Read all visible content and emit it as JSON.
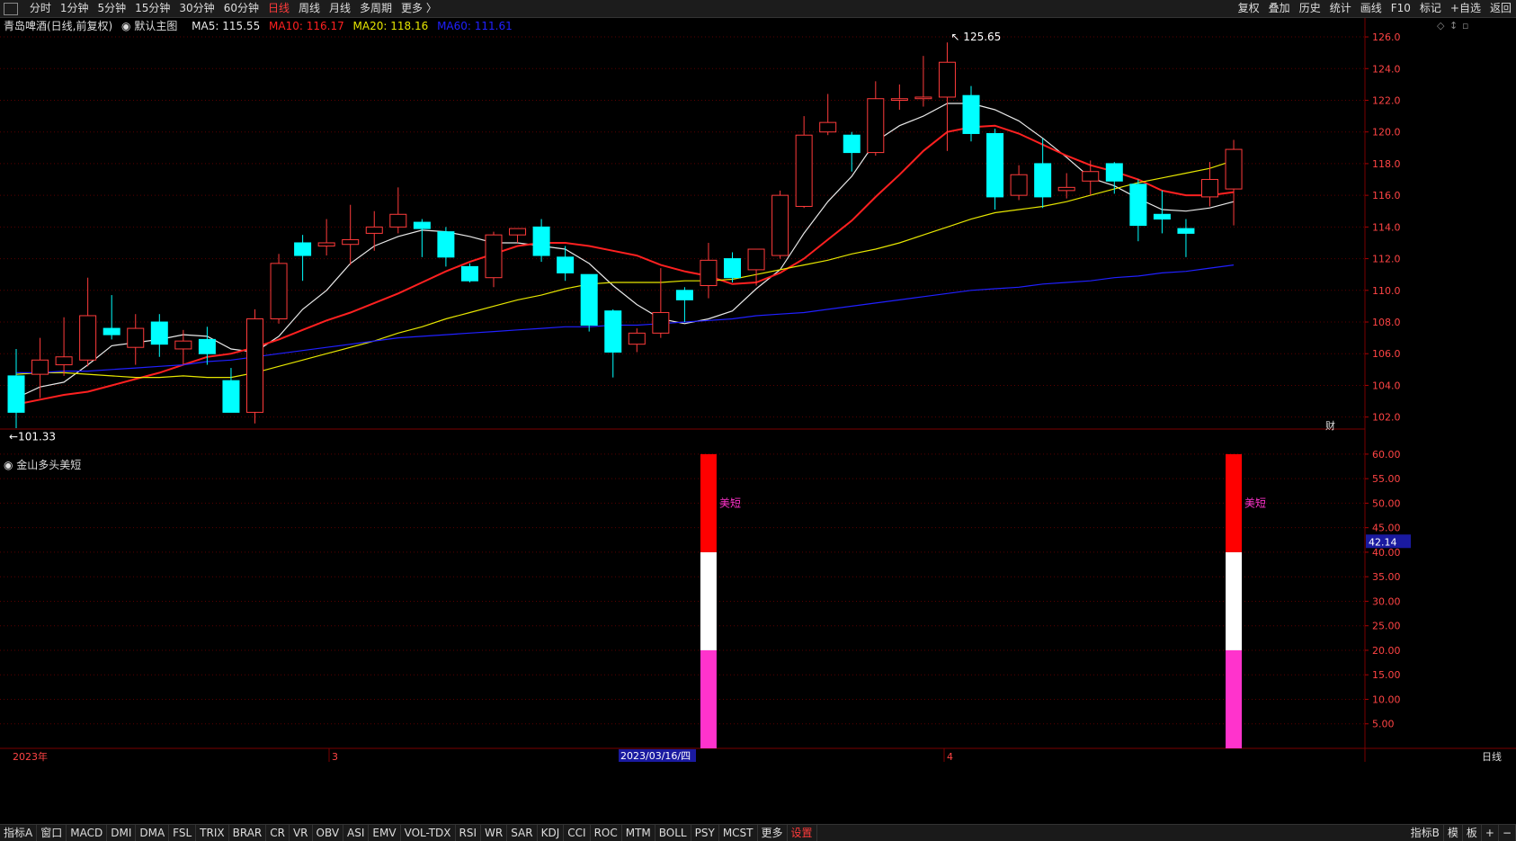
{
  "toolbar": {
    "periods": [
      "分时",
      "1分钟",
      "5分钟",
      "15分钟",
      "30分钟",
      "60分钟",
      "日线",
      "周线",
      "月线",
      "多周期",
      "更多 〉"
    ],
    "active_period": "日线",
    "right_items": [
      "复权",
      "叠加",
      "历史",
      "统计",
      "画线",
      "F10",
      "标记",
      "+自选",
      "返回"
    ]
  },
  "info": {
    "stock": "青岛啤酒(日线,前复权)",
    "main_label": "默认主图",
    "ma5": "MA5: 115.55",
    "ma10": "MA10: 116.17",
    "ma20": "MA20: 118.16",
    "ma60": "MA60: 111.61"
  },
  "sub_title": "金山多头美短",
  "bottom": {
    "indicators": [
      "指标A",
      "窗口",
      "MACD",
      "DMI",
      "DMA",
      "FSL",
      "TRIX",
      "BRAR",
      "CR",
      "VR",
      "OBV",
      "ASI",
      "EMV",
      "VOL-TDX",
      "RSI",
      "WR",
      "SAR",
      "KDJ",
      "CCI",
      "ROC",
      "MTM",
      "BOLL",
      "PSY",
      "MCST",
      "更多",
      "设置"
    ],
    "right_items": [
      "指标B",
      "模",
      "板",
      "+",
      "−"
    ]
  },
  "axis_labels": {
    "year": "2023年",
    "month3": "3",
    "cursor_date": "2023/03/16/四",
    "month4": "4",
    "period_label": "日线",
    "cursor_value": "42.14",
    "fin_marker": "财",
    "signal_label": "美短"
  },
  "colors": {
    "up": "#ff3b3b",
    "down": "#00ffff",
    "ma5": "#e8e8e8",
    "ma10": "#ff2020",
    "ma20": "#e6e600",
    "ma60": "#2020ff",
    "magenta": "#ff33cc",
    "grid": "#5a0000"
  },
  "chart_data": [
    {
      "type": "candlestick",
      "title": "青岛啤酒(日线,前复权)",
      "ylim": [
        101,
        126.5
      ],
      "y_ticks": [
        102,
        104,
        106,
        108,
        110,
        112,
        114,
        116,
        118,
        120,
        122,
        124,
        126
      ],
      "high_annotation": "125.65",
      "low_annotation": "101.33",
      "candles": [
        {
          "o": 104.6,
          "h": 106.3,
          "l": 101.3,
          "c": 102.3
        },
        {
          "o": 104.7,
          "h": 107.0,
          "l": 103.2,
          "c": 105.6
        },
        {
          "o": 105.3,
          "h": 108.3,
          "l": 104.6,
          "c": 105.8
        },
        {
          "o": 105.6,
          "h": 110.8,
          "l": 105.2,
          "c": 108.4
        },
        {
          "o": 107.6,
          "h": 109.7,
          "l": 106.9,
          "c": 107.2
        },
        {
          "o": 106.4,
          "h": 108.5,
          "l": 105.3,
          "c": 107.6
        },
        {
          "o": 108.0,
          "h": 108.5,
          "l": 105.8,
          "c": 106.6
        },
        {
          "o": 106.3,
          "h": 107.5,
          "l": 105.3,
          "c": 106.8
        },
        {
          "o": 106.9,
          "h": 107.7,
          "l": 105.3,
          "c": 106.0
        },
        {
          "o": 104.3,
          "h": 105.1,
          "l": 102.7,
          "c": 102.3
        },
        {
          "o": 102.3,
          "h": 108.8,
          "l": 101.6,
          "c": 108.2
        },
        {
          "o": 108.2,
          "h": 112.3,
          "l": 107.9,
          "c": 111.7
        },
        {
          "o": 113.0,
          "h": 113.5,
          "l": 110.6,
          "c": 112.2
        },
        {
          "o": 112.8,
          "h": 114.5,
          "l": 112.2,
          "c": 113.0
        },
        {
          "o": 112.9,
          "h": 115.4,
          "l": 111.6,
          "c": 113.2
        },
        {
          "o": 113.6,
          "h": 115.0,
          "l": 112.5,
          "c": 114.0
        },
        {
          "o": 114.0,
          "h": 116.5,
          "l": 113.6,
          "c": 114.8
        },
        {
          "o": 114.3,
          "h": 114.5,
          "l": 112.1,
          "c": 113.9
        },
        {
          "o": 113.7,
          "h": 114.0,
          "l": 111.5,
          "c": 112.1
        },
        {
          "o": 111.5,
          "h": 111.7,
          "l": 110.5,
          "c": 110.6
        },
        {
          "o": 110.8,
          "h": 113.7,
          "l": 110.2,
          "c": 113.5
        },
        {
          "o": 113.5,
          "h": 113.8,
          "l": 113.0,
          "c": 113.9
        },
        {
          "o": 114.0,
          "h": 114.5,
          "l": 111.8,
          "c": 112.2
        },
        {
          "o": 112.1,
          "h": 112.8,
          "l": 110.6,
          "c": 111.1
        },
        {
          "o": 111.0,
          "h": 111.0,
          "l": 107.4,
          "c": 107.8
        },
        {
          "o": 108.7,
          "h": 108.8,
          "l": 104.5,
          "c": 106.1
        },
        {
          "o": 106.6,
          "h": 107.6,
          "l": 106.1,
          "c": 107.3
        },
        {
          "o": 107.3,
          "h": 111.4,
          "l": 107.0,
          "c": 108.6
        },
        {
          "o": 110.0,
          "h": 110.2,
          "l": 108.0,
          "c": 109.4
        },
        {
          "o": 110.3,
          "h": 113.0,
          "l": 109.5,
          "c": 111.9
        },
        {
          "o": 112.0,
          "h": 112.4,
          "l": 110.5,
          "c": 110.8
        },
        {
          "o": 111.3,
          "h": 112.6,
          "l": 110.3,
          "c": 112.6
        },
        {
          "o": 112.2,
          "h": 116.3,
          "l": 112.0,
          "c": 116.0
        },
        {
          "o": 115.3,
          "h": 121.0,
          "l": 115.2,
          "c": 119.8
        },
        {
          "o": 120.0,
          "h": 122.4,
          "l": 119.8,
          "c": 120.6
        },
        {
          "o": 119.8,
          "h": 120.0,
          "l": 117.5,
          "c": 118.7
        },
        {
          "o": 118.7,
          "h": 123.2,
          "l": 118.5,
          "c": 122.1
        },
        {
          "o": 122.0,
          "h": 123.0,
          "l": 121.4,
          "c": 122.1
        },
        {
          "o": 122.1,
          "h": 124.8,
          "l": 121.6,
          "c": 122.2
        },
        {
          "o": 122.2,
          "h": 125.65,
          "l": 118.8,
          "c": 124.4
        },
        {
          "o": 122.3,
          "h": 122.9,
          "l": 119.4,
          "c": 119.9
        },
        {
          "o": 119.9,
          "h": 120.2,
          "l": 115.1,
          "c": 115.9
        },
        {
          "o": 116.0,
          "h": 117.9,
          "l": 115.7,
          "c": 117.3
        },
        {
          "o": 118.0,
          "h": 119.6,
          "l": 115.2,
          "c": 115.9
        },
        {
          "o": 116.3,
          "h": 117.4,
          "l": 115.8,
          "c": 116.5
        },
        {
          "o": 116.9,
          "h": 118.2,
          "l": 116.0,
          "c": 117.5
        },
        {
          "o": 118.0,
          "h": 118.1,
          "l": 116.1,
          "c": 116.9
        },
        {
          "o": 116.7,
          "h": 117.0,
          "l": 113.1,
          "c": 114.1
        },
        {
          "o": 114.8,
          "h": 116.3,
          "l": 113.6,
          "c": 114.5
        },
        {
          "o": 113.9,
          "h": 114.5,
          "l": 112.1,
          "c": 113.6
        },
        {
          "o": 115.9,
          "h": 118.1,
          "l": 115.3,
          "c": 117.0
        },
        {
          "o": 116.4,
          "h": 119.5,
          "l": 114.1,
          "c": 118.9
        }
      ],
      "series": [
        {
          "name": "MA5",
          "values": [
            103.2,
            103.9,
            104.2,
            105.3,
            106.5,
            106.7,
            106.9,
            107.2,
            107.1,
            106.3,
            106.1,
            107.1,
            108.8,
            110.0,
            111.7,
            112.8,
            113.4,
            113.8,
            113.7,
            113.4,
            113.0,
            113.0,
            112.8,
            112.6,
            111.7,
            110.3,
            109.1,
            108.2,
            107.9,
            108.2,
            108.7,
            110.1,
            111.3,
            113.6,
            115.6,
            117.2,
            119.4,
            120.4,
            121.0,
            121.8,
            121.8,
            121.4,
            120.7,
            119.6,
            118.4,
            117.1,
            116.6,
            115.8,
            115.1,
            115.0,
            115.2,
            115.6
          ]
        },
        {
          "name": "MA10",
          "values": [
            102.8,
            103.1,
            103.4,
            103.6,
            104.0,
            104.4,
            104.8,
            105.3,
            105.8,
            106.0,
            106.4,
            106.9,
            107.5,
            108.1,
            108.6,
            109.2,
            109.8,
            110.5,
            111.2,
            111.8,
            112.3,
            112.8,
            113.0,
            113.0,
            112.8,
            112.5,
            112.2,
            111.6,
            111.2,
            110.9,
            110.4,
            110.5,
            111.1,
            112.0,
            113.2,
            114.4,
            115.9,
            117.3,
            118.8,
            120.0,
            120.3,
            120.4,
            119.9,
            119.2,
            118.5,
            117.9,
            117.5,
            117.0,
            116.3,
            116.0,
            116.0,
            116.2
          ]
        },
        {
          "name": "MA20",
          "values": [
            104.7,
            104.8,
            104.8,
            104.7,
            104.6,
            104.5,
            104.5,
            104.6,
            104.5,
            104.5,
            104.8,
            105.2,
            105.6,
            106.0,
            106.4,
            106.8,
            107.3,
            107.7,
            108.2,
            108.6,
            109.0,
            109.4,
            109.7,
            110.1,
            110.4,
            110.5,
            110.5,
            110.5,
            110.6,
            110.6,
            110.7,
            111.0,
            111.3,
            111.6,
            111.9,
            112.3,
            112.6,
            113.0,
            113.5,
            114.0,
            114.5,
            114.9,
            115.1,
            115.3,
            115.6,
            116.0,
            116.4,
            116.8,
            117.1,
            117.4,
            117.7,
            118.2
          ]
        },
        {
          "name": "MA60",
          "values": [
            104.8,
            104.8,
            104.9,
            104.9,
            105.0,
            105.1,
            105.2,
            105.3,
            105.5,
            105.6,
            105.8,
            106.0,
            106.2,
            106.4,
            106.6,
            106.8,
            107.0,
            107.1,
            107.2,
            107.3,
            107.4,
            107.5,
            107.6,
            107.7,
            107.7,
            107.8,
            107.8,
            107.9,
            108.0,
            108.1,
            108.2,
            108.4,
            108.5,
            108.6,
            108.8,
            109.0,
            109.2,
            109.4,
            109.6,
            109.8,
            110.0,
            110.1,
            110.2,
            110.4,
            110.5,
            110.6,
            110.8,
            110.9,
            111.1,
            111.2,
            111.4,
            111.6
          ]
        }
      ]
    },
    {
      "type": "bar",
      "title": "金山多头美短",
      "ylim": [
        0,
        62
      ],
      "y_ticks": [
        5,
        10,
        15,
        20,
        25,
        30,
        35,
        40,
        45,
        50,
        55,
        60
      ],
      "bars": [
        {
          "index": 29,
          "segments": [
            {
              "from": 0,
              "to": 20,
              "color": "#ff33cc"
            },
            {
              "from": 20,
              "to": 40,
              "color": "#ffffff"
            },
            {
              "from": 40,
              "to": 60,
              "color": "#ff0000"
            }
          ],
          "label": "美短",
          "label_value": 50
        },
        {
          "index": 51,
          "segments": [
            {
              "from": 0,
              "to": 20,
              "color": "#ff33cc"
            },
            {
              "from": 20,
              "to": 40,
              "color": "#ffffff"
            },
            {
              "from": 40,
              "to": 60,
              "color": "#ff0000"
            }
          ],
          "label": "美短",
          "label_value": 50
        }
      ]
    }
  ]
}
